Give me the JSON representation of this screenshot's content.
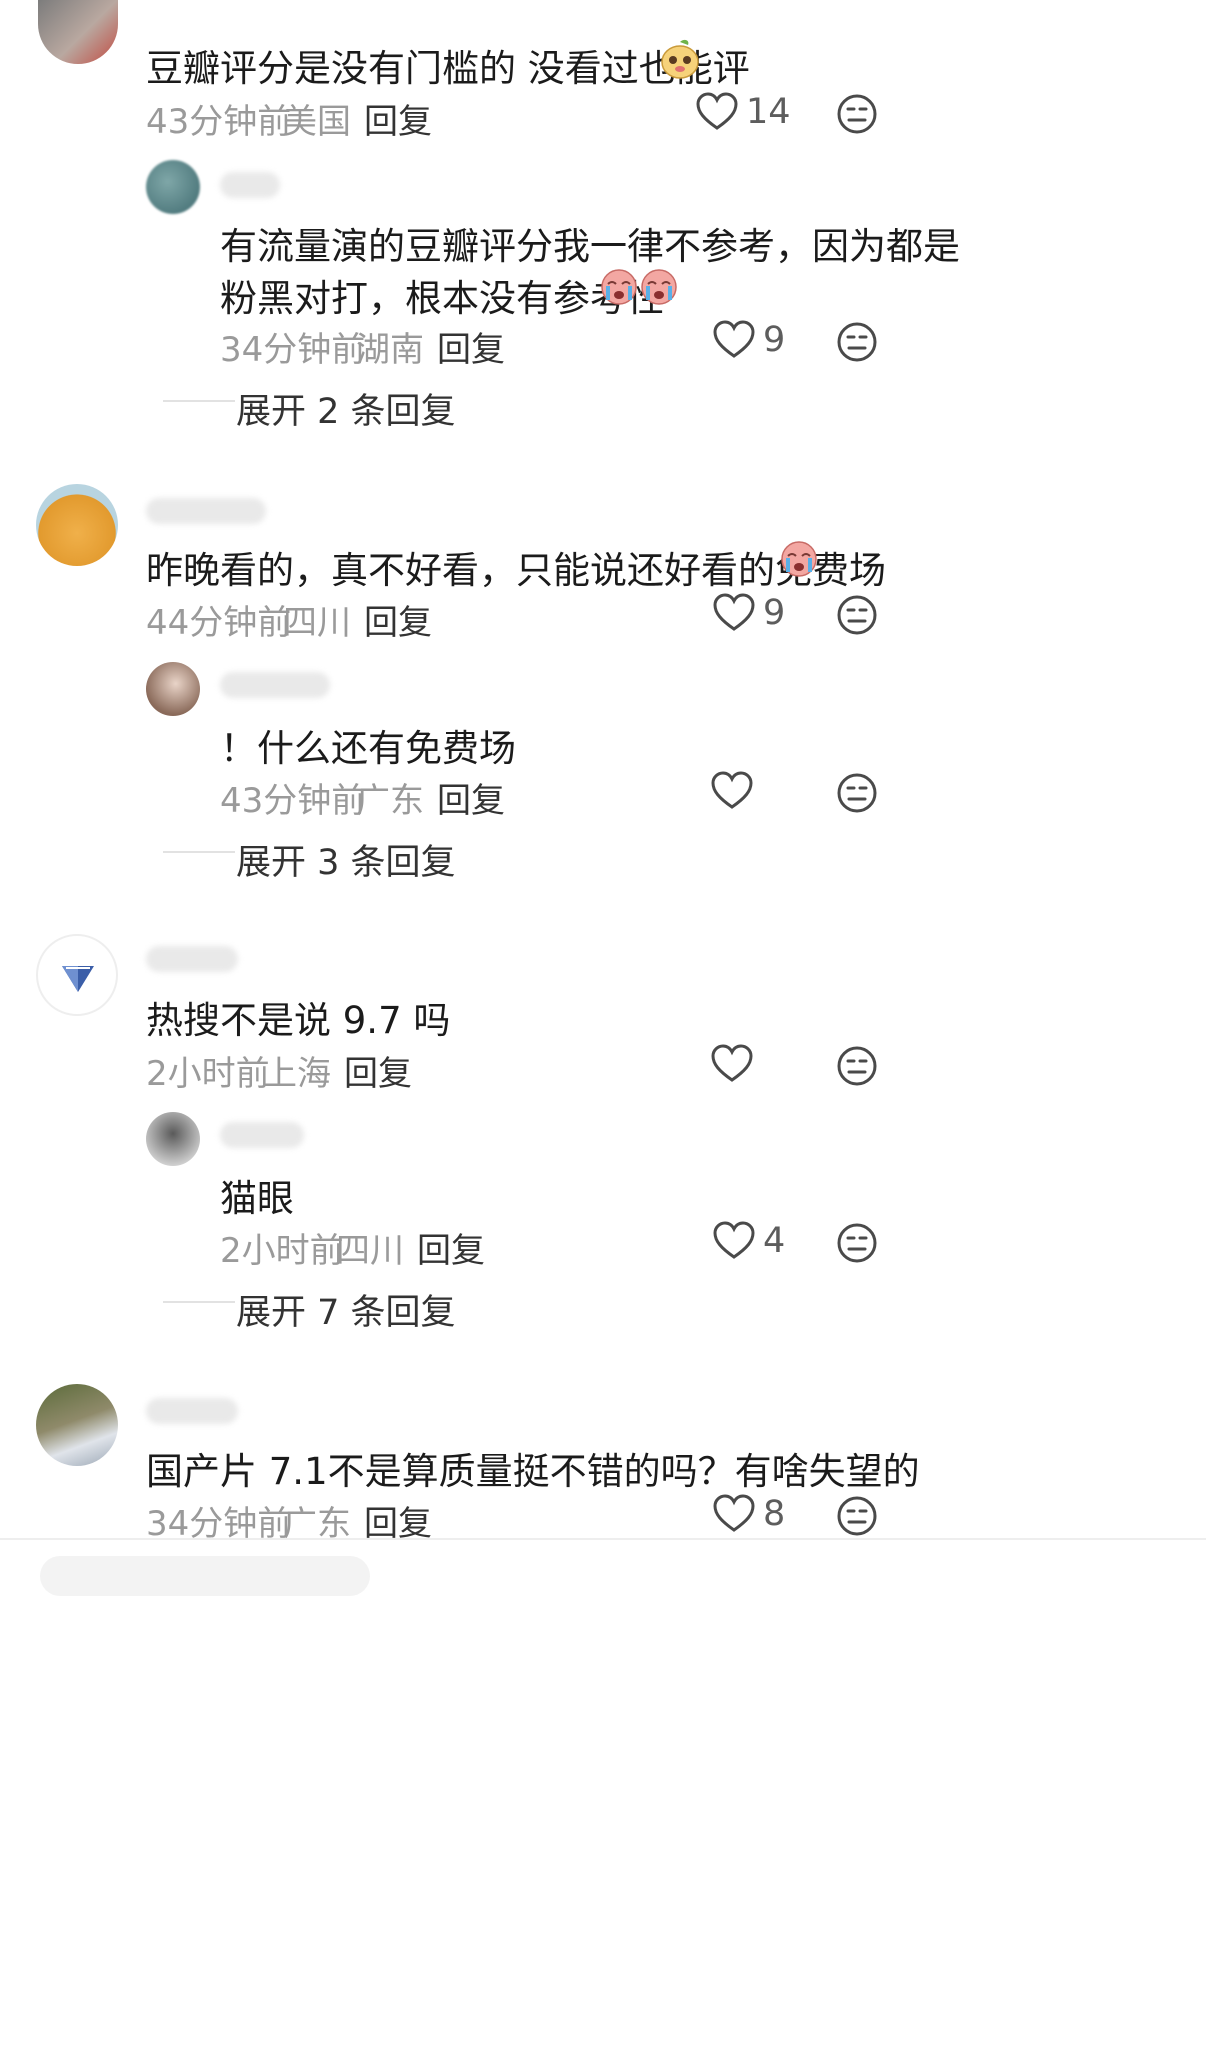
{
  "comments": [
    {
      "text": "豆瓣评分是没有门槛的 没看过也能评",
      "time": "43分钟前",
      "location": "美国",
      "reply_label": "回复",
      "likes": "14",
      "reply": {
        "text_line1": "有流量演的豆瓣评分我一律不参考，因为都是",
        "text_line2": "粉黑对打，根本没有参考性",
        "time": "34分钟前",
        "location": "湖南",
        "reply_label": "回复",
        "likes": "9"
      },
      "expand_label": "展开 2 条回复"
    },
    {
      "text": "昨晚看的，真不好看，只能说还好看的免费场",
      "time": "44分钟前",
      "location": "四川",
      "reply_label": "回复",
      "likes": "9",
      "reply": {
        "text_line1": "！什么还有免费场",
        "time": "43分钟前",
        "location": "广东",
        "reply_label": "回复",
        "likes": ""
      },
      "expand_label": "展开 3 条回复"
    },
    {
      "text": "热搜不是说 9.7 吗",
      "time": "2小时前",
      "location": "上海",
      "reply_label": "回复",
      "likes": "",
      "reply": {
        "text_line1": "猫眼",
        "time": "2小时前",
        "location": "四川",
        "reply_label": "回复",
        "likes": "4"
      },
      "expand_label": "展开 7 条回复"
    },
    {
      "text": "国产片 7.1不是算质量挺不错的吗？有啥失望的",
      "time": "34分钟前",
      "location": "广东",
      "reply_label": "回复",
      "likes": "8"
    }
  ],
  "icons": {
    "like": "heart-outline-icon",
    "dislike": "meh-face-icon",
    "emoji_1": "peach-smiley-emoji",
    "emoji_2": "crying-face-emoji"
  },
  "colors": {
    "meta_text": "#9a9a9a",
    "body_text": "#1b1b1b",
    "icon_stroke": "#4a4a4a"
  }
}
